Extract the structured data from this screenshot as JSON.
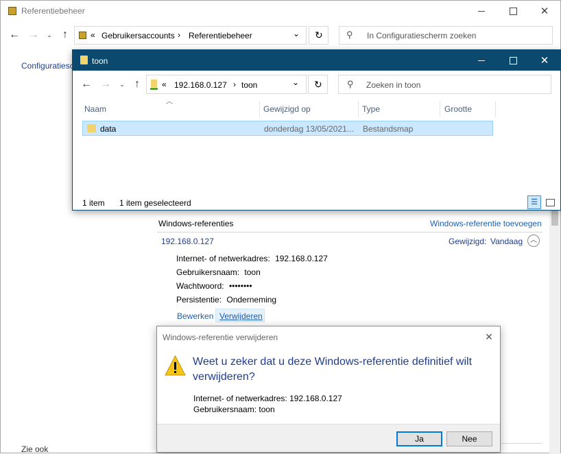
{
  "main_window": {
    "title": "Referentiebeheer",
    "breadcrumb": {
      "overflow": "«",
      "items": [
        "Gebruikersaccounts",
        "Referentiebeheer"
      ]
    },
    "search_placeholder": "In Configuratiescherm zoeken",
    "sidebar_link": "Configuratiesc",
    "section_title": "Windows-referenties",
    "add_link": "Windows-referentie toevoegen",
    "credential": {
      "name": "192.168.0.127",
      "modified_label": "Gewijzigd:",
      "modified_value": "Vandaag",
      "fields": [
        {
          "label": "Internet- of netwerkadres:",
          "value": "192.168.0.127"
        },
        {
          "label": "Gebruikersnaam:",
          "value": "toon"
        },
        {
          "label": "Wachtwoord:",
          "value": "••••••••"
        },
        {
          "label": "Persistentie:",
          "value": "Onderneming"
        }
      ],
      "edit_link": "Bewerken",
      "remove_link": "Verwijderen"
    },
    "see_also": "Zie ook"
  },
  "explorer": {
    "title": "toon",
    "breadcrumb": {
      "overflow": "«",
      "items": [
        "192.168.0.127",
        "toon"
      ]
    },
    "search_placeholder": "Zoeken in toon",
    "columns": [
      "Naam",
      "Gewijzigd op",
      "Type",
      "Grootte"
    ],
    "rows": [
      {
        "name": "data",
        "modified": "donderdag 13/05/2021...",
        "type": "Bestandsmap",
        "size": ""
      }
    ],
    "status_count": "1 item",
    "status_selected": "1 item geselecteerd",
    "title_bar_color": "#0b4a6e"
  },
  "dialog": {
    "title": "Windows-referentie verwijderen",
    "question": "Weet u zeker dat u deze Windows-referentie definitief wilt verwijderen?",
    "detail_address": "Internet- of netwerkadres: 192.168.0.127",
    "detail_user": "Gebruikersnaam: toon",
    "yes_label": "Ja",
    "no_label": "Nee",
    "heading_color": "#1e3d8f"
  }
}
